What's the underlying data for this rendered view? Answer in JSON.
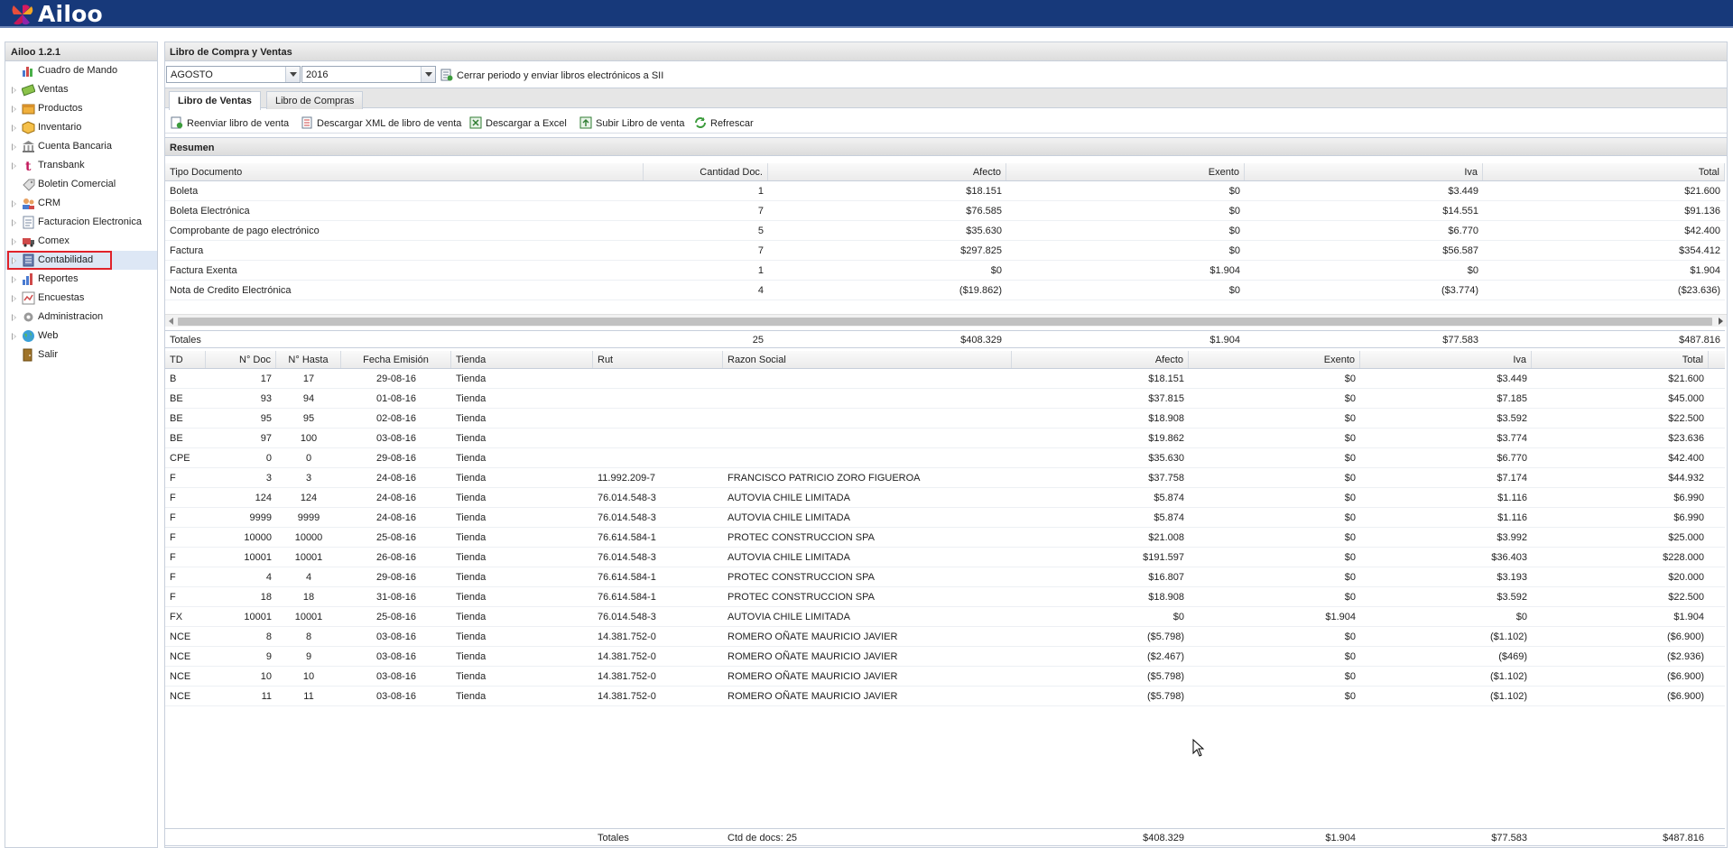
{
  "app": {
    "logo_text": "Ailoo",
    "version": "Ailoo 1.2.1"
  },
  "sidebar": {
    "items": [
      {
        "label": "Cuadro de Mando",
        "icon": "chart-icon",
        "expandable": false
      },
      {
        "label": "Ventas",
        "icon": "money-icon",
        "expandable": true
      },
      {
        "label": "Productos",
        "icon": "box-icon",
        "expandable": true
      },
      {
        "label": "Inventario",
        "icon": "package-icon",
        "expandable": true
      },
      {
        "label": "Cuenta Bancaria",
        "icon": "bank-icon",
        "expandable": true
      },
      {
        "label": "Transbank",
        "icon": "transbank-icon",
        "expandable": true
      },
      {
        "label": "Boletin Comercial",
        "icon": "tag-icon",
        "expandable": false
      },
      {
        "label": "CRM",
        "icon": "people-icon",
        "expandable": true
      },
      {
        "label": "Facturacion Electronica",
        "icon": "document-icon",
        "expandable": true
      },
      {
        "label": "Comex",
        "icon": "truck-icon",
        "expandable": true
      },
      {
        "label": "Contabilidad",
        "icon": "ledger-icon",
        "expandable": true,
        "selected": true
      },
      {
        "label": "Reportes",
        "icon": "bar-chart-icon",
        "expandable": true
      },
      {
        "label": "Encuestas",
        "icon": "survey-icon",
        "expandable": true
      },
      {
        "label": "Administracion",
        "icon": "gear-icon",
        "expandable": true
      },
      {
        "label": "Web",
        "icon": "globe-icon",
        "expandable": true
      },
      {
        "label": "Salir",
        "icon": "exit-icon",
        "expandable": false
      }
    ]
  },
  "main": {
    "title": "Libro de Compra y Ventas",
    "month": "AGOSTO",
    "year": "2016",
    "close_period_label": "Cerrar periodo y enviar libros electrónicos a SII",
    "tabs": [
      {
        "label": "Libro de Ventas",
        "active": true
      },
      {
        "label": "Libro de Compras",
        "active": false
      }
    ],
    "actions": [
      {
        "label": "Reenviar libro de venta",
        "icon": "resend-icon"
      },
      {
        "label": "Descargar XML de libro de venta",
        "icon": "xml-icon"
      },
      {
        "label": "Descargar a Excel",
        "icon": "excel-icon"
      },
      {
        "label": "Subir Libro de venta",
        "icon": "upload-icon"
      },
      {
        "label": "Refrescar",
        "icon": "refresh-icon"
      }
    ],
    "summary_title": "Resumen"
  },
  "summary": {
    "headers": [
      "Tipo Documento",
      "Cantidad Doc.",
      "Afecto",
      "Exento",
      "Iva",
      "Total"
    ],
    "rows": [
      [
        "Boleta",
        "1",
        "$18.151",
        "$0",
        "$3.449",
        "$21.600"
      ],
      [
        "Boleta Electrónica",
        "7",
        "$76.585",
        "$0",
        "$14.551",
        "$91.136"
      ],
      [
        "Comprobante de pago electrónico",
        "5",
        "$35.630",
        "$0",
        "$6.770",
        "$42.400"
      ],
      [
        "Factura",
        "7",
        "$297.825",
        "$0",
        "$56.587",
        "$354.412"
      ],
      [
        "Factura Exenta",
        "1",
        "$0",
        "$1.904",
        "$0",
        "$1.904"
      ],
      [
        "Nota de Credito Electrónica",
        "4",
        "($19.862)",
        "$0",
        "($3.774)",
        "($23.636)"
      ]
    ],
    "totals": [
      "Totales",
      "25",
      "$408.329",
      "$1.904",
      "$77.583",
      "$487.816"
    ]
  },
  "detail": {
    "headers": [
      "TD",
      "N° Doc",
      "N° Hasta",
      "Fecha Emisión",
      "Tienda",
      "Rut",
      "Razon Social",
      "Afecto",
      "Exento",
      "Iva",
      "Total"
    ],
    "rows": [
      [
        "B",
        "17",
        "17",
        "29-08-16",
        "Tienda",
        "",
        "",
        "$18.151",
        "$0",
        "$3.449",
        "$21.600"
      ],
      [
        "BE",
        "93",
        "94",
        "01-08-16",
        "Tienda",
        "",
        "",
        "$37.815",
        "$0",
        "$7.185",
        "$45.000"
      ],
      [
        "BE",
        "95",
        "95",
        "02-08-16",
        "Tienda",
        "",
        "",
        "$18.908",
        "$0",
        "$3.592",
        "$22.500"
      ],
      [
        "BE",
        "97",
        "100",
        "03-08-16",
        "Tienda",
        "",
        "",
        "$19.862",
        "$0",
        "$3.774",
        "$23.636"
      ],
      [
        "CPE",
        "0",
        "0",
        "29-08-16",
        "Tienda",
        "",
        "",
        "$35.630",
        "$0",
        "$6.770",
        "$42.400"
      ],
      [
        "F",
        "3",
        "3",
        "24-08-16",
        "Tienda",
        "11.992.209-7",
        "FRANCISCO PATRICIO ZORO FIGUEROA",
        "$37.758",
        "$0",
        "$7.174",
        "$44.932"
      ],
      [
        "F",
        "124",
        "124",
        "24-08-16",
        "Tienda",
        "76.014.548-3",
        "AUTOVIA CHILE LIMITADA",
        "$5.874",
        "$0",
        "$1.116",
        "$6.990"
      ],
      [
        "F",
        "9999",
        "9999",
        "24-08-16",
        "Tienda",
        "76.014.548-3",
        "AUTOVIA CHILE LIMITADA",
        "$5.874",
        "$0",
        "$1.116",
        "$6.990"
      ],
      [
        "F",
        "10000",
        "10000",
        "25-08-16",
        "Tienda",
        "76.614.584-1",
        "PROTEC CONSTRUCCION SPA",
        "$21.008",
        "$0",
        "$3.992",
        "$25.000"
      ],
      [
        "F",
        "10001",
        "10001",
        "26-08-16",
        "Tienda",
        "76.014.548-3",
        "AUTOVIA CHILE LIMITADA",
        "$191.597",
        "$0",
        "$36.403",
        "$228.000"
      ],
      [
        "F",
        "4",
        "4",
        "29-08-16",
        "Tienda",
        "76.614.584-1",
        "PROTEC CONSTRUCCION SPA",
        "$16.807",
        "$0",
        "$3.193",
        "$20.000"
      ],
      [
        "F",
        "18",
        "18",
        "31-08-16",
        "Tienda",
        "76.614.584-1",
        "PROTEC CONSTRUCCION SPA",
        "$18.908",
        "$0",
        "$3.592",
        "$22.500"
      ],
      [
        "FX",
        "10001",
        "10001",
        "25-08-16",
        "Tienda",
        "76.014.548-3",
        "AUTOVIA CHILE LIMITADA",
        "$0",
        "$1.904",
        "$0",
        "$1.904"
      ],
      [
        "NCE",
        "8",
        "8",
        "03-08-16",
        "Tienda",
        "14.381.752-0",
        "ROMERO OÑATE MAURICIO JAVIER",
        "($5.798)",
        "$0",
        "($1.102)",
        "($6.900)"
      ],
      [
        "NCE",
        "9",
        "9",
        "03-08-16",
        "Tienda",
        "14.381.752-0",
        "ROMERO OÑATE MAURICIO JAVIER",
        "($2.467)",
        "$0",
        "($469)",
        "($2.936)"
      ],
      [
        "NCE",
        "10",
        "10",
        "03-08-16",
        "Tienda",
        "14.381.752-0",
        "ROMERO OÑATE MAURICIO JAVIER",
        "($5.798)",
        "$0",
        "($1.102)",
        "($6.900)"
      ],
      [
        "NCE",
        "11",
        "11",
        "03-08-16",
        "Tienda",
        "14.381.752-0",
        "ROMERO OÑATE MAURICIO JAVIER",
        "($5.798)",
        "$0",
        "($1.102)",
        "($6.900)"
      ]
    ],
    "totals": {
      "label": "Totales",
      "count": "Ctd de docs: 25",
      "afecto": "$408.329",
      "exento": "$1.904",
      "iva": "$77.583",
      "total": "$487.816"
    }
  },
  "colors": {
    "topbar": "#17397a",
    "selection_outline": "#e0222a",
    "selected_bg": "#dde7f5"
  }
}
